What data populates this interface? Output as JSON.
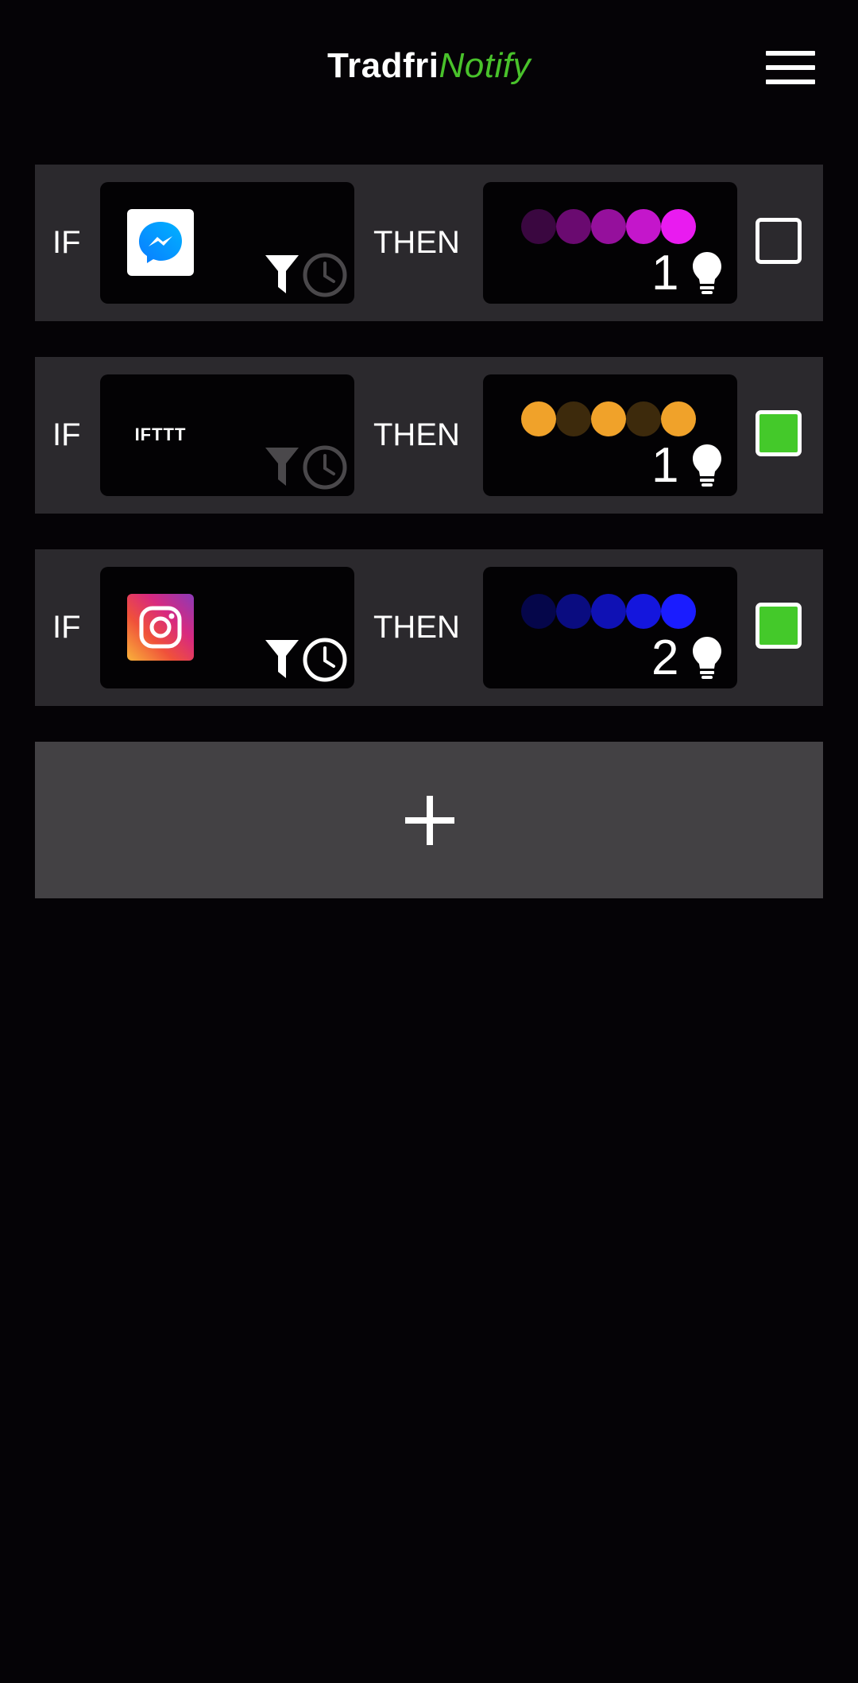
{
  "header": {
    "title_part1": "Tradfri",
    "title_part2": "Notify",
    "accent_color": "#49c22b",
    "menu_icon": "hamburger-menu-icon"
  },
  "rules": [
    {
      "if_label": "IF",
      "then_label": "THEN",
      "trigger_app": "messenger-icon",
      "filter_enabled": true,
      "schedule_enabled": false,
      "colors": [
        "#3a0740",
        "#6a0a70",
        "#95109c",
        "#c416cb",
        "#e91bf0"
      ],
      "bulb_count": "1",
      "enabled": false
    },
    {
      "if_label": "IF",
      "then_label": "THEN",
      "trigger_app": "ifttt-icon",
      "trigger_text": "IFTTT",
      "filter_enabled": false,
      "schedule_enabled": false,
      "colors": [
        "#f0a22a",
        "#3d2a0c",
        "#f0a22a",
        "#3d2a0c",
        "#f0a22a"
      ],
      "bulb_count": "1",
      "enabled": true
    },
    {
      "if_label": "IF",
      "then_label": "THEN",
      "trigger_app": "instagram-icon",
      "filter_enabled": true,
      "schedule_enabled": true,
      "colors": [
        "#05064a",
        "#0a0c80",
        "#0f11b4",
        "#1416dd",
        "#1a1cff"
      ],
      "bulb_count": "2",
      "enabled": true
    }
  ],
  "add_button": {
    "icon": "plus-icon"
  },
  "colors": {
    "background": "#050306",
    "card": "#2b292d",
    "inner_box": "#030204",
    "add_button": "#434144",
    "toggle_on": "#44c92a"
  }
}
